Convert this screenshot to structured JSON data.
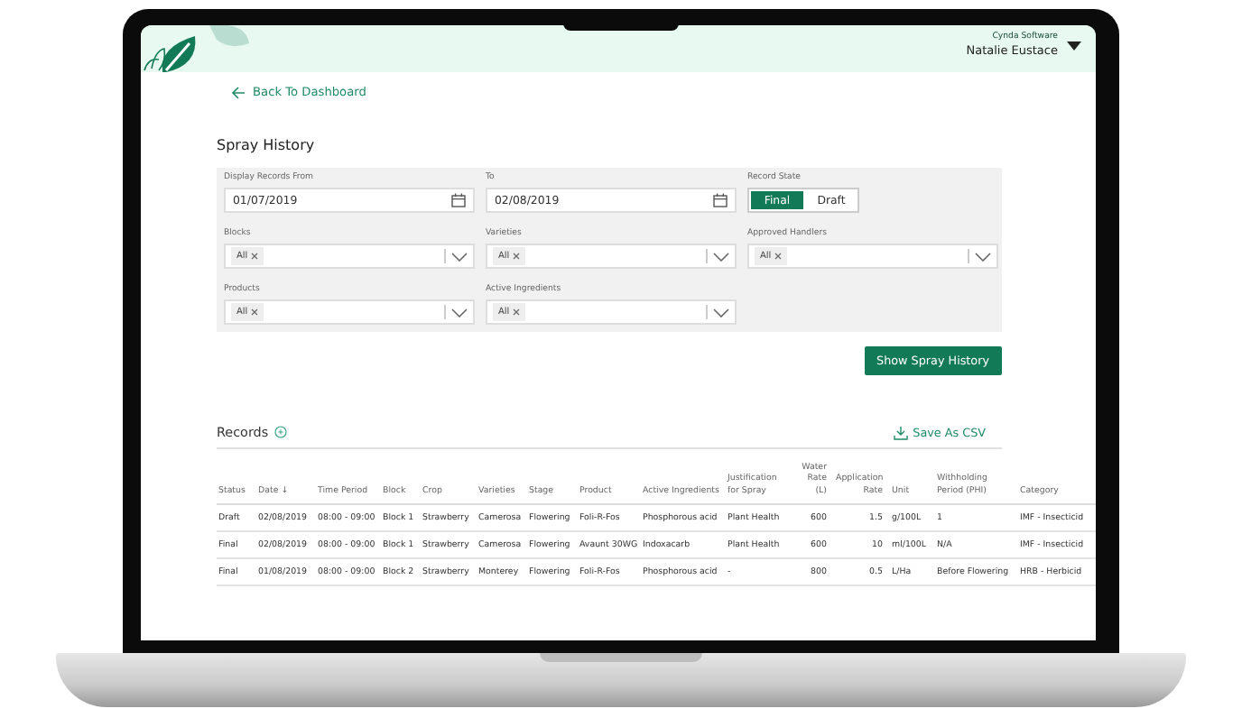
{
  "header": {
    "company": "Cynda Software",
    "user": "Natalie Eustace"
  },
  "back_link": "Back To Dashboard",
  "page_title": "Spray History",
  "filters": {
    "date_from": {
      "label": "Display Records From",
      "value": "01/07/2019"
    },
    "date_to": {
      "label": "To",
      "value": "02/08/2019"
    },
    "record_state": {
      "label": "Record State",
      "options": [
        {
          "label": "Final",
          "selected": true
        },
        {
          "label": "Draft",
          "selected": false
        }
      ]
    },
    "selects": [
      {
        "label": "Blocks",
        "tags": [
          "All"
        ]
      },
      {
        "label": "Varieties",
        "tags": [
          "All"
        ]
      },
      {
        "label": "Approved Handlers",
        "tags": [
          "All"
        ]
      },
      {
        "label": "Products",
        "tags": [
          "All"
        ]
      },
      {
        "label": "Active Ingredients",
        "tags": [
          "All"
        ]
      }
    ]
  },
  "submit_button": "Show Spray History",
  "records": {
    "title": "Records",
    "export_link": "Save As CSV",
    "columns": [
      "Status",
      "Date ↓",
      "Time Period",
      "Block",
      "Crop",
      "Varieties",
      "Stage",
      "Product",
      "Active Ingredients",
      "Justification for Spray",
      "Water Rate (L)",
      "Application Rate",
      "Unit",
      "Withholding Period (PHI)",
      "Category"
    ],
    "rows": [
      [
        "Draft",
        "02/08/2019",
        "08:00 - 09:00",
        "Block 1",
        "Strawberry",
        "Camerosa",
        "Flowering",
        "Foli-R-Fos",
        "Phosphorous acid",
        "Plant Health",
        "600",
        "1.5",
        "g/100L",
        "1",
        "IMF - Insecticid"
      ],
      [
        "Final",
        "02/08/2019",
        "08:00 - 09:00",
        "Block 1",
        "Strawberry",
        "Camerosa",
        "Flowering",
        "Avaunt 30WG",
        "Indoxacarb",
        "Plant Health",
        "600",
        "10",
        "ml/100L",
        "N/A",
        "IMF - Insecticid"
      ],
      [
        "Final",
        "01/08/2019",
        "08:00 - 09:00",
        "Block 2",
        "Strawberry",
        "Monterey",
        "Flowering",
        "Foli-R-Fos",
        "Phosphorous acid",
        "-",
        "800",
        "0.5",
        "L/Ha",
        "Before Flowering",
        "HRB - Herbicid"
      ]
    ]
  }
}
